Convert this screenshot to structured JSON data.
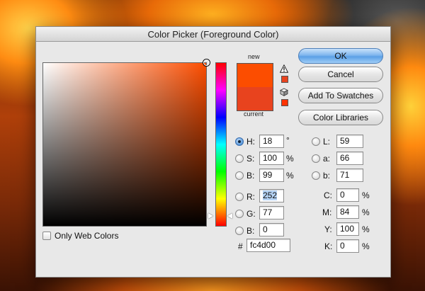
{
  "dialog": {
    "title": "Color Picker (Foreground Color)"
  },
  "colors": {
    "new": "#fc4d00",
    "current": "#e8431e",
    "gamut_swatch": "#e8431e",
    "web_swatch": "#ff3300"
  },
  "swatches": {
    "new_label": "new",
    "current_label": "current"
  },
  "icons": {
    "gamut_warning": "warning-triangle-icon",
    "web_safe": "cube-icon"
  },
  "buttons": {
    "ok": "OK",
    "cancel": "Cancel",
    "add_to_swatches": "Add To Swatches",
    "color_libraries": "Color Libraries"
  },
  "hsb": {
    "h_label": "H:",
    "h_value": "18",
    "h_unit": "°",
    "s_label": "S:",
    "s_value": "100",
    "s_unit": "%",
    "b_label": "B:",
    "b_value": "99",
    "b_unit": "%"
  },
  "rgb": {
    "r_label": "R:",
    "r_value": "252",
    "g_label": "G:",
    "g_value": "77",
    "b_label": "B:",
    "b_value": "0"
  },
  "lab": {
    "l_label": "L:",
    "l_value": "59",
    "a_label": "a:",
    "a_value": "66",
    "b_label": "b:",
    "b_value": "71"
  },
  "cmyk": {
    "c_label": "C:",
    "c_value": "0",
    "m_label": "M:",
    "m_value": "84",
    "y_label": "Y:",
    "y_value": "100",
    "k_label": "K:",
    "k_value": "0",
    "unit": "%"
  },
  "hex": {
    "label": "#",
    "value": "fc4d00"
  },
  "options": {
    "only_web_colors": "Only Web Colors"
  }
}
